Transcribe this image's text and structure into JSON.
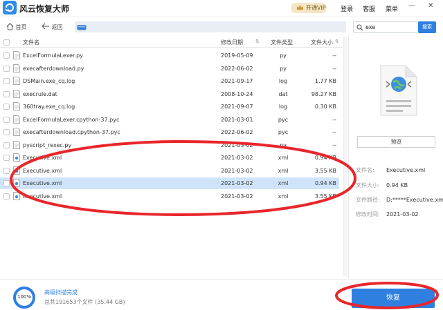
{
  "app": {
    "title": "风云恢复大师"
  },
  "titlebar": {
    "vip_label": "开通VIP",
    "menu": [
      "登录",
      "客服",
      "菜单"
    ],
    "minimize": "—",
    "close": "✕"
  },
  "addressbar": {
    "home_label": "首页",
    "back_label": "返回",
    "search_value": "exe",
    "search_button": "搜索"
  },
  "columns": {
    "name": "文件名",
    "date": "修改日期",
    "type": "文件类型",
    "size": "文件大小"
  },
  "files": [
    {
      "name": "ExcelFormulaLexer.py",
      "date": "2019-05-09",
      "type": "py",
      "size": "--"
    },
    {
      "name": "execafterdownload.py",
      "date": "2022-06-02",
      "type": "py",
      "size": "--"
    },
    {
      "name": "DSMain.exe_cq.log",
      "date": "2021-09-17",
      "type": "log",
      "size": "1.77  KB"
    },
    {
      "name": "execrule.dat",
      "date": "2008-10-24",
      "type": "dat",
      "size": "98.27  KB"
    },
    {
      "name": "360tray.exe_cq.log",
      "date": "2021-09-07",
      "type": "log",
      "size": "0.30  KB"
    },
    {
      "name": "ExcelFormulaLexer.cpython-37.pyc",
      "date": "2021-03-01",
      "type": "pyc",
      "size": "--"
    },
    {
      "name": "execafterdownload.cpython-37.pyc",
      "date": "2022-06-02",
      "type": "pyc",
      "size": "--"
    },
    {
      "name": "pyscript_rexec.py",
      "date": "2021-03-02",
      "type": "py",
      "size": "--"
    },
    {
      "name": "Executive.xml",
      "date": "2021-03-02",
      "type": "xml",
      "size": "0.94  KB"
    },
    {
      "name": "Executive.xml",
      "date": "2021-03-02",
      "type": "xml",
      "size": "3.55  KB"
    },
    {
      "name": "Executive.xml",
      "date": "2021-03-02",
      "type": "xml",
      "size": "0.94  KB"
    },
    {
      "name": "Executive.xml",
      "date": "2021-03-02",
      "type": "xml",
      "size": "3.55  KB"
    }
  ],
  "selected_index": 10,
  "preview": {
    "button": "预览",
    "details": [
      {
        "key": "文件名:",
        "value": "Executive.xml"
      },
      {
        "key": "文件大小:",
        "value": "0.94 KB"
      },
      {
        "key": "文件路径:",
        "value": "D:*****Executive.xml"
      },
      {
        "key": "修改时间:",
        "value": "2021-03-02"
      }
    ]
  },
  "status": {
    "progress_label": "100%",
    "progress": 1.0,
    "scan_done": "高级扫描完成",
    "total": "总共191653个文件 (35.44 GB)"
  },
  "recover_button": "恢复",
  "colors": {
    "accent": "#2f7fe0",
    "selected_row": "#cfe4fa",
    "annotation": "#e8262b"
  }
}
